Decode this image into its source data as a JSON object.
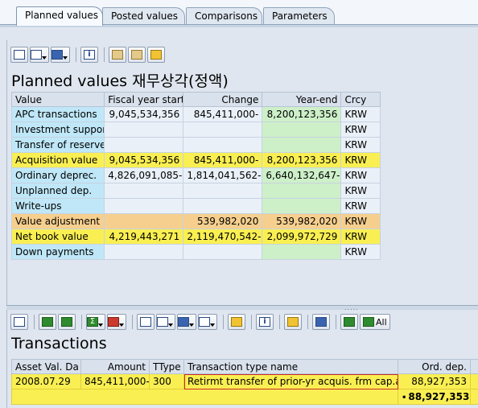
{
  "tabs": [
    {
      "label": "Planned values",
      "active": true
    },
    {
      "label": "Posted values",
      "active": false
    },
    {
      "label": "Comparisons",
      "active": false
    },
    {
      "label": "Parameters",
      "active": false
    }
  ],
  "planned": {
    "title": "Planned values 재무상각(정액)",
    "columns": [
      "Value",
      "Fiscal year start",
      "Change",
      "Year-end",
      "Crcy"
    ],
    "rows": [
      {
        "label": "APC transactions",
        "start": "9,045,534,356",
        "change": "845,411,000-",
        "end": "8,200,123,356",
        "crcy": "KRW",
        "style": ""
      },
      {
        "label": "Investment support",
        "start": "",
        "change": "",
        "end": "",
        "crcy": "KRW",
        "style": ""
      },
      {
        "label": "Transfer of reserves",
        "start": "",
        "change": "",
        "end": "",
        "crcy": "KRW",
        "style": ""
      },
      {
        "label": "Acquisition value",
        "start": "9,045,534,356",
        "change": "845,411,000-",
        "end": "8,200,123,356",
        "crcy": "KRW",
        "style": "yel"
      },
      {
        "label": "Ordinary deprec.",
        "start": "4,826,091,085-",
        "change": "1,814,041,562-",
        "end": "6,640,132,647-",
        "crcy": "KRW",
        "style": ""
      },
      {
        "label": "Unplanned dep.",
        "start": "",
        "change": "",
        "end": "",
        "crcy": "KRW",
        "style": ""
      },
      {
        "label": "Write-ups",
        "start": "",
        "change": "",
        "end": "",
        "crcy": "KRW",
        "style": ""
      },
      {
        "label": "Value adjustment",
        "start": "",
        "change": "539,982,020",
        "end": "539,982,020",
        "crcy": "KRW",
        "style": "org"
      },
      {
        "label": "Net book value",
        "start": "4,219,443,271",
        "change": "2,119,470,542-",
        "end": "2,099,972,729",
        "crcy": "KRW",
        "style": "yel"
      },
      {
        "label": "Down payments",
        "start": "",
        "change": "",
        "end": "",
        "crcy": "KRW",
        "style": ""
      }
    ]
  },
  "transactions": {
    "title": "Transactions",
    "columns": [
      "Asset Val. Da",
      "Amount",
      "TType",
      "Transaction type name",
      "Ord. dep."
    ],
    "row": {
      "date": "2008.07.29",
      "amount": "845,411,000-",
      "ttype": "300",
      "name": "Retirmt transfer of prior-yr acquis. frm cap.asset",
      "orddep": "88,927,353"
    },
    "total": "88,927,353",
    "total_marker": "•",
    "sum_marker": "Σ",
    "all_label": "All"
  },
  "colors": {
    "label_bg": "#bfe7f7",
    "highlight_yellow": "#f9ef52",
    "highlight_orange": "#f6cf8e",
    "year_end_green": "#cdf0c9"
  }
}
